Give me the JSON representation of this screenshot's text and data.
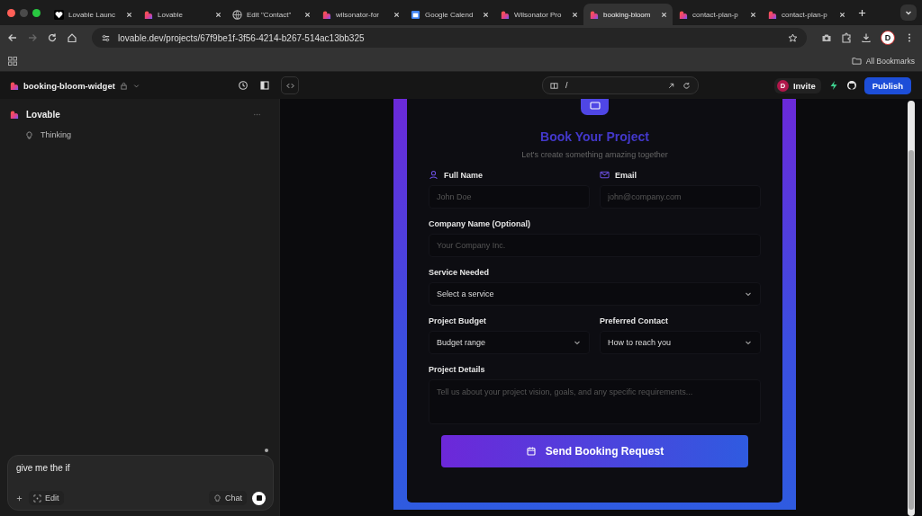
{
  "browser": {
    "tabs": [
      {
        "label": "Lovable Launc",
        "kind": "heart",
        "selected": false
      },
      {
        "label": "Lovable",
        "kind": "lovable",
        "selected": false
      },
      {
        "label": "Edit \"Contact\"",
        "kind": "globe",
        "selected": false
      },
      {
        "label": "wilsonator-for",
        "kind": "lovable",
        "selected": false
      },
      {
        "label": "Google Calend",
        "kind": "calendar",
        "selected": false
      },
      {
        "label": "Wilsonator Pro",
        "kind": "lovable",
        "selected": false
      },
      {
        "label": "booking-bloom",
        "kind": "lovable",
        "selected": true
      },
      {
        "label": "contact-plan-p",
        "kind": "lovable",
        "selected": false
      },
      {
        "label": "contact-plan-p",
        "kind": "lovable",
        "selected": false
      }
    ],
    "url": "lovable.dev/projects/67f9be1f-3f56-4214-b267-514ac13bb325",
    "profile_initial": "D",
    "bookmarks_label": "All Bookmarks"
  },
  "app_header": {
    "project_name": "booking-bloom-widget",
    "preview_path": "/",
    "invite_initial": "D",
    "invite_label": "Invite",
    "publish_label": "Publish"
  },
  "chat": {
    "author": "Lovable",
    "status": "Thinking",
    "input_value": "give me the if",
    "edit_label": "Edit",
    "chat_label": "Chat"
  },
  "preview": {
    "title": "Book Your Project",
    "subtitle": "Let's create something amazing together",
    "rows": [
      [
        {
          "label": "Full Name",
          "kind": "name",
          "placeholder": "John Doe"
        },
        {
          "label": "Email",
          "kind": "email",
          "placeholder": "john@company.com"
        }
      ],
      [
        {
          "label": "Company Name (Optional)",
          "kind": "text",
          "placeholder": "Your Company Inc."
        }
      ],
      [
        {
          "label": "Service Needed",
          "kind": "select",
          "value": "Select a service"
        }
      ],
      [
        {
          "label": "Project Budget",
          "kind": "select",
          "value": "Budget range"
        },
        {
          "label": "Preferred Contact",
          "kind": "select",
          "value": "How to reach you"
        }
      ],
      [
        {
          "label": "Project Details",
          "kind": "textarea",
          "placeholder": "Tell us about your project vision, goals, and any specific requirements..."
        }
      ]
    ],
    "submit_label": "Send Booking Request"
  }
}
